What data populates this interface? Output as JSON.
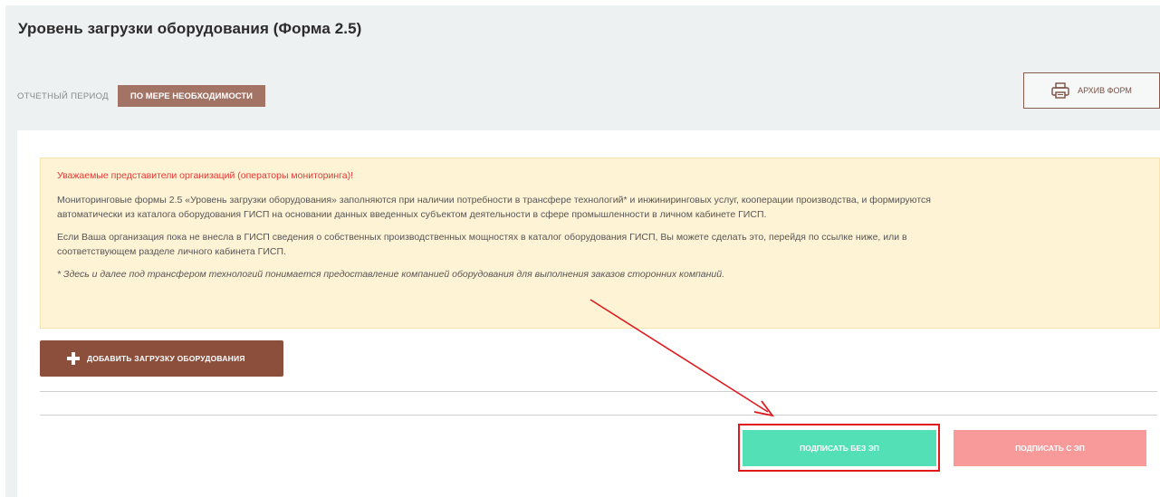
{
  "header": {
    "title": "Уровень загрузки оборудования (Форма 2.5)",
    "period_label": "ОТЧЕТНЫЙ ПЕРИОД",
    "period_value": "ПО МЕРЕ НЕОБХОДИМОСТИ",
    "archive_button": {
      "label": "АРХИВ ФОРМ",
      "icon": "printer-icon"
    }
  },
  "notice": {
    "headline": "Уважаемые представители организаций (операторы мониторинга)!",
    "paragraph_1_line_1": "Мониторинговые формы 2.5 «Уровень загрузки оборудования» заполняются при наличии потребности в трансфере технологий* и инжиниринговых услуг, кооперации производства, и формируются",
    "paragraph_1_line_2": "автоматически из каталога оборудования ГИСП на основании данных введенных субъектом деятельности в сфере промышленности в личном кабинете ГИСП.",
    "paragraph_2_line_1": "Если Ваша организация пока не внесла в ГИСП сведения о собственных производственных мощностях в каталог оборудования ГИСП, Вы можете сделать это, перейдя по ссылке ниже, или в",
    "paragraph_2_line_2": "соответствующем разделе личного кабинета ГИСП.",
    "footnote": "* Здесь и далее под трансфером технологий понимается предоставление компанией оборудования для выполнения заказов сторонних компаний."
  },
  "actions": {
    "add_button": {
      "label": "ДОБАВИТЬ ЗАГРУЗКУ ОБОРУДОВАНИЯ",
      "icon": "plus-icon"
    },
    "sign_without_ep": {
      "label": "ПОДПИСАТЬ БЕЗ ЭП"
    },
    "sign_with_ep": {
      "label": "ПОДПИСАТЬ С ЭП"
    }
  },
  "colors": {
    "accent_brown": "#8b4f3c",
    "badge_brown": "#a37466",
    "sign_green": "#53e0b7",
    "sign_pink": "#f79a99",
    "notice_bg": "#fff3d5",
    "annotation_red": "#e0191d"
  }
}
